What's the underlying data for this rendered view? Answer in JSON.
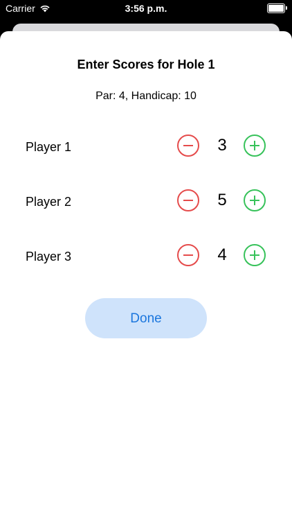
{
  "status_bar": {
    "carrier": "Carrier",
    "time": "3:56 p.m.",
    "battery_level": 1.0
  },
  "sheet": {
    "title": "Enter Scores for Hole 1",
    "subtitle": "Par: 4, Handicap: 10"
  },
  "players": [
    {
      "name": "Player 1",
      "score": "3"
    },
    {
      "name": "Player 2",
      "score": "5"
    },
    {
      "name": "Player 3",
      "score": "4"
    }
  ],
  "done_label": "Done",
  "colors": {
    "minus": "#e54b4b",
    "plus": "#37c25a",
    "done_bg": "#cfe3fb",
    "done_text": "#1b76dd"
  },
  "icons": {
    "minus": "minus-circle-icon",
    "plus": "plus-circle-icon",
    "wifi": "wifi-icon",
    "battery": "battery-icon"
  }
}
